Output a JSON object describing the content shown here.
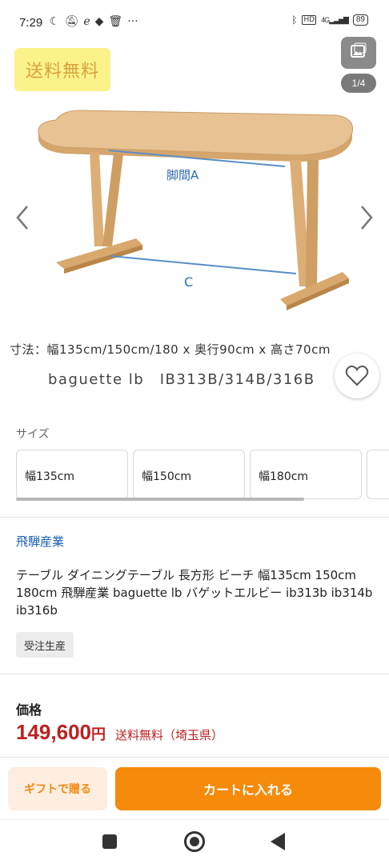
{
  "status_bar": {
    "time": "7:29",
    "left_icons": [
      "moon-icon",
      "bell-off-icon",
      "e-icon",
      "box-icon",
      "trash-icon",
      "more-icon"
    ],
    "network": "4G",
    "battery": "89"
  },
  "gallery": {
    "badge": "送料無料",
    "counter": "1/4",
    "image_labels": {
      "leg_span": "脚間A",
      "base": "C"
    },
    "caption_dims": "寸法：幅135cm/150cm/180 x 奥行90cm x 高さ70cm",
    "caption_model": "baguette lb　IB313B/314B/316B"
  },
  "size": {
    "label": "サイズ",
    "options": [
      "幅135cm",
      "幅150cm",
      "幅180cm"
    ]
  },
  "product": {
    "brand": "飛騨産業",
    "title": "テーブル ダイニングテーブル 長方形 ビーチ 幅135cm 150cm 180cm 飛騨産業 baguette lb バゲットエルビー ib313b ib314b ib316b",
    "order_badge": "受注生産"
  },
  "price": {
    "label": "価格",
    "value": "149,600",
    "currency": "円",
    "shipping": "送料無料（埼玉県）"
  },
  "actions": {
    "gift": "ギフトで贈る",
    "cart": "カートに入れる"
  },
  "colors": {
    "accent_orange": "#f58a0b",
    "price_red": "#bf1f1f",
    "link_blue": "#1a5fb4"
  }
}
